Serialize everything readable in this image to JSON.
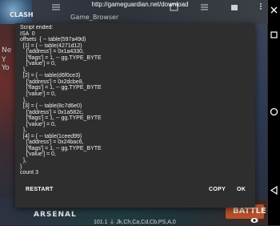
{
  "browser": {
    "url": "http://gameguardian.net/download"
  },
  "background": {
    "logo_text": "CLASH",
    "app_title": "Game_Browser",
    "left_text_lines": [
      "Ne",
      "Y",
      "Yo"
    ],
    "bottom_left_label": "ARSENAL",
    "bottom_right_label": "BATTLE",
    "status_line": "101.1 ⏚ Jk,Ch,Ca,Cd,Cb,PS,A,0"
  },
  "dialog": {
    "script_output": "Script ended:\nISA  0\noffsets  { -- table(597a49d)\n  [1] = { -- table(4271d12)\n    ['address'] = 0x1a4330,\n    ['flags'] = 1, -- gg.TYPE_BYTE\n    ['value'] = 0,\n  },\n  [2] = { -- table(d6f0ce3)\n    ['address'] = 0x2dcbe8,\n    ['flags'] = 1, -- gg.TYPE_BYTE\n    ['value'] = 0,\n  },\n  [3] = { -- table(8c7d6e0)\n    ['address'] = 0x1a582c,\n    ['flags'] = 1, -- gg.TYPE_BYTE\n    ['value'] = 0,\n  },\n  [4] = { -- table(1ceed99)\n    ['address'] = 0x24bac6,\n    ['flags'] = 1, -- gg.TYPE_BYTE\n    ['value'] = 0,\n  },\n}\ncount 3",
    "buttons": {
      "restart": "RESTART",
      "copy": "COPY",
      "ok": "OK"
    }
  },
  "navbar": {
    "icons": [
      "close-icon",
      "square-icon",
      "circle-icon",
      "back-triangle-icon",
      "eye-icon"
    ]
  },
  "colors": {
    "dialog_bg": "#2e2e2e",
    "text": "#f0f0f0",
    "navbar_bg": "#000000"
  }
}
